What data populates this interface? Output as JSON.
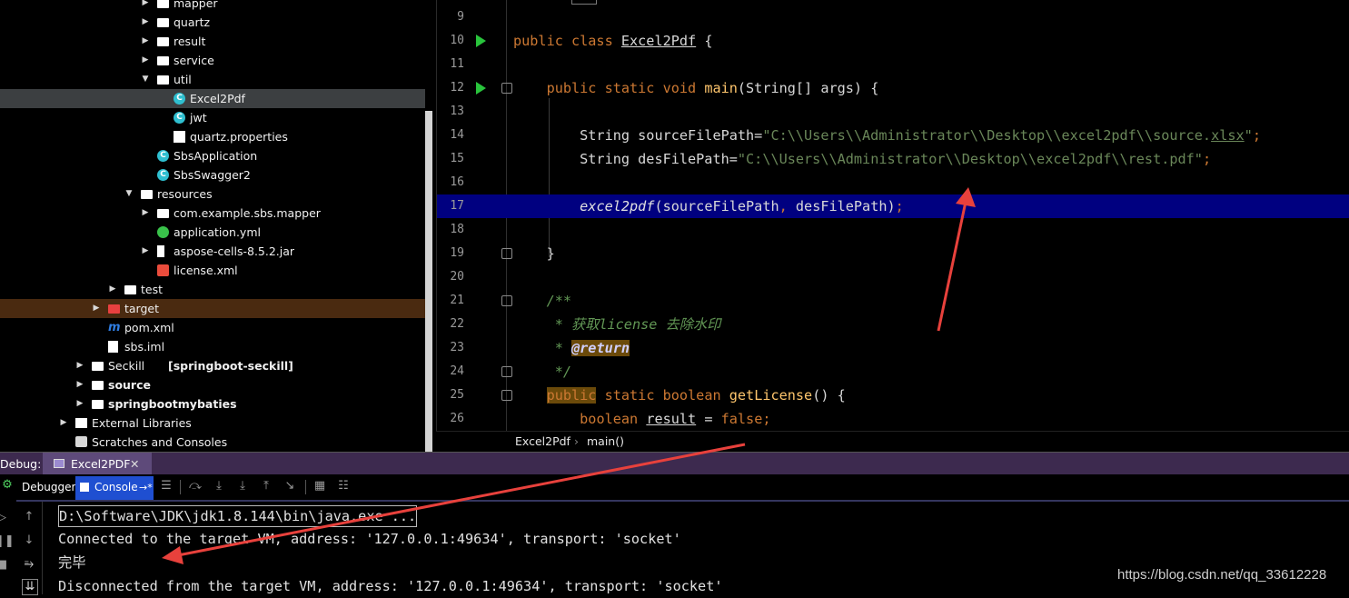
{
  "project_tree": {
    "items": [
      {
        "label": "mapper",
        "icon": "package-folder-icon",
        "level": 3,
        "arrow": "▶"
      },
      {
        "label": "quartz",
        "icon": "package-folder-icon",
        "level": 3,
        "arrow": "▶"
      },
      {
        "label": "result",
        "icon": "package-folder-icon",
        "level": 3,
        "arrow": "▶"
      },
      {
        "label": "service",
        "icon": "package-folder-icon",
        "level": 3,
        "arrow": "▶"
      },
      {
        "label": "util",
        "icon": "package-folder-icon",
        "level": 3,
        "arrow": "▼"
      },
      {
        "label": "Excel2Pdf",
        "icon": "java-class-icon",
        "level": 4,
        "arrow": "",
        "selected": true
      },
      {
        "label": "jwt",
        "icon": "java-class-icon",
        "level": 4,
        "arrow": ""
      },
      {
        "label": "quartz.properties",
        "icon": "properties-file-icon",
        "level": 4,
        "arrow": ""
      },
      {
        "label": "SbsApplication",
        "icon": "spring-boot-class-icon",
        "level": 3,
        "arrow": ""
      },
      {
        "label": "SbsSwagger2",
        "icon": "java-class-icon",
        "level": 3,
        "arrow": ""
      },
      {
        "label": "resources",
        "icon": "resources-folder-icon",
        "level": 2,
        "arrow": "▼"
      },
      {
        "label": "com.example.sbs.mapper",
        "icon": "folder-icon",
        "level": 3,
        "arrow": "▶"
      },
      {
        "label": "application.yml",
        "icon": "yaml-file-icon",
        "level": 3,
        "arrow": ""
      },
      {
        "label": "aspose-cells-8.5.2.jar",
        "icon": "jar-file-icon",
        "level": 3,
        "arrow": "▶"
      },
      {
        "label": "license.xml",
        "icon": "xml-file-icon",
        "level": 3,
        "arrow": ""
      },
      {
        "label": "test",
        "icon": "folder-icon",
        "level": 1,
        "arrow": "▶"
      },
      {
        "label": "target",
        "icon": "excluded-folder-icon",
        "level": 0,
        "arrow": "▶",
        "highlight": true
      },
      {
        "label": "pom.xml",
        "icon": "maven-icon",
        "level": 0,
        "arrow": ""
      },
      {
        "label": "sbs.iml",
        "icon": "iml-file-icon",
        "level": 0,
        "arrow": ""
      },
      {
        "label": "Seckill",
        "bold_suffix": "[springboot-seckill]",
        "icon": "module-folder-icon",
        "level": -1,
        "arrow": "▶"
      },
      {
        "label": "source",
        "icon": "module-folder-icon",
        "level": -1,
        "arrow": "▶",
        "bold": true
      },
      {
        "label": "springbootmybaties",
        "icon": "module-folder-icon",
        "level": -1,
        "arrow": "▶",
        "bold": true
      },
      {
        "label": "External Libraries",
        "icon": "libraries-icon",
        "level": -2,
        "arrow": "▶"
      },
      {
        "label": "Scratches and Consoles",
        "icon": "scratches-icon",
        "level": -2,
        "arrow": ""
      }
    ]
  },
  "editor": {
    "lines": [
      {
        "n": "9",
        "html": ""
      },
      {
        "n": "10",
        "run": true,
        "html": "<span class=\"kw\">public class </span><span class=\"und\">Excel2Pdf</span> {"
      },
      {
        "n": "11",
        "html": ""
      },
      {
        "n": "12",
        "run": true,
        "fold": true,
        "html": "    <span class=\"kw\">public static void </span><span class=\"fn\">main</span>(String[] args) {"
      },
      {
        "n": "13",
        "html": ""
      },
      {
        "n": "14",
        "html": "        String sourceFilePath=<span class=\"str\">\"C:\\\\Users\\\\Administrator\\\\Desktop\\\\excel2pdf\\\\source.<span class=\"und\">xlsx</span>\"</span><span class=\"kw\">;</span>"
      },
      {
        "n": "15",
        "html": "        String desFilePath=<span class=\"str\">\"C:\\\\Users\\\\Administrator\\\\Desktop\\\\excel2pdf\\\\rest.pdf\"</span><span class=\"kw\">;</span>"
      },
      {
        "n": "16",
        "html": ""
      },
      {
        "n": "17",
        "current": true,
        "html": "        <span style=\"font-style:italic;color:#e0e0e0\">excel2pdf</span>(sourceFilePath<span class=\"kw\">, </span>desFilePath)<span class=\"kw\">;</span>"
      },
      {
        "n": "18",
        "html": ""
      },
      {
        "n": "19",
        "fold": true,
        "html": "    }"
      },
      {
        "n": "20",
        "html": ""
      },
      {
        "n": "21",
        "fold": true,
        "html": "    <span class=\"cmt\">/**</span>"
      },
      {
        "n": "22",
        "html": "     <span class=\"cmt\">* 获取license 去除水印</span>"
      },
      {
        "n": "23",
        "html": "     <span class=\"cmt\">* </span><span class=\"tag\">@return</span>"
      },
      {
        "n": "24",
        "fold": true,
        "html": "     <span class=\"cmt\">*/</span>"
      },
      {
        "n": "25",
        "fold": true,
        "html": "    <span class=\"kw hl\">public</span><span class=\"kw\"> static boolean </span><span class=\"fn\">getLicense</span>() {"
      },
      {
        "n": "26",
        "html": "        <span class=\"kw\">boolean </span><span class=\"und\">result</span> = <span class=\"kw\">false;</span>"
      }
    ]
  },
  "breadcrumb": {
    "file": "Excel2Pdf",
    "sep": "›",
    "method": "main()"
  },
  "debug": {
    "title": "Debug:",
    "tab_label": "Excel2PDF",
    "tab_close": "✕",
    "tabs": {
      "debugger": "Debugger",
      "console": "Console",
      "console_arrow": "→*"
    }
  },
  "console": {
    "lines": [
      "D:\\Software\\JDK\\jdk1.8.144\\bin\\java.exe ...",
      "Connected to the target VM, address: '127.0.0.1:49634', transport: 'socket'",
      "完毕",
      "Disconnected from the target VM, address: '127.0.0.1:49634', transport: 'socket'"
    ]
  },
  "watermark": "https://blog.csdn.net/qq_33612228",
  "colors": {
    "accent": "#1f4fd1",
    "current_line": "#000080",
    "keyword": "#cc7832",
    "string": "#6a8759",
    "annotation_arrow": "#e8413c"
  }
}
